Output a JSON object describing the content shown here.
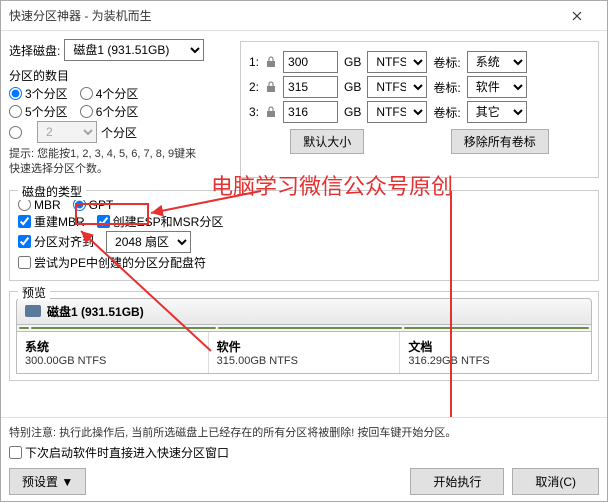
{
  "window": {
    "title": "快速分区神器 - 为装机而生"
  },
  "left": {
    "select_disk_label": "选择磁盘:",
    "selected_disk": "磁盘1 (931.51GB)",
    "partition_count_label": "分区的数目",
    "opt3": "3个分区",
    "opt4": "4个分区",
    "opt5": "5个分区",
    "opt6": "6个分区",
    "opt_custom_num": "2",
    "opt_custom_suffix": "个分区",
    "hint_line1": "提示: 您能按1, 2, 3, 4, 5, 6, 7, 8, 9键来",
    "hint_line2": "快速选择分区个数。"
  },
  "disk_type": {
    "label": "磁盘的类型",
    "mbr": "MBR",
    "gpt": "GPT",
    "rebuild_mbr": "重建MBR",
    "create_esp_msr": "创建ESP和MSR分区",
    "align_label": "分区对齐到",
    "align_value": "2048 扇区",
    "try_pe": "尝试为PE中创建的分区分配盘符"
  },
  "partitions": [
    {
      "idx": "1:",
      "size": "300",
      "unit": "GB",
      "fs": "NTFS",
      "vol_label": "卷标:",
      "vol": "系统"
    },
    {
      "idx": "2:",
      "size": "315",
      "unit": "GB",
      "fs": "NTFS",
      "vol_label": "卷标:",
      "vol": "软件"
    },
    {
      "idx": "3:",
      "size": "316",
      "unit": "GB",
      "fs": "NTFS",
      "vol_label": "卷标:",
      "vol": "其它"
    }
  ],
  "right": {
    "default_size_btn": "默认大小",
    "remove_all_vols_btn": "移除所有卷标"
  },
  "preview": {
    "label": "预览",
    "disk_name": "磁盘1 (931.51GB)",
    "parts": [
      {
        "name": "系统",
        "size": "300.00GB NTFS"
      },
      {
        "name": "软件",
        "size": "315.00GB NTFS"
      },
      {
        "name": "文档",
        "size": "316.29GB NTFS"
      }
    ]
  },
  "bottom": {
    "warning": "特别注意: 执行此操作后, 当前所选磁盘上已经存在的所有分区将被删除! 按回车键开始分区。",
    "next_direct": "下次启动软件时直接进入快速分区窗口",
    "preset_btn": "预设置",
    "preset_arrow": "▼",
    "start_btn": "开始执行",
    "cancel_btn": "取消(C)"
  },
  "watermark": "电脑学习微信公众号原创"
}
